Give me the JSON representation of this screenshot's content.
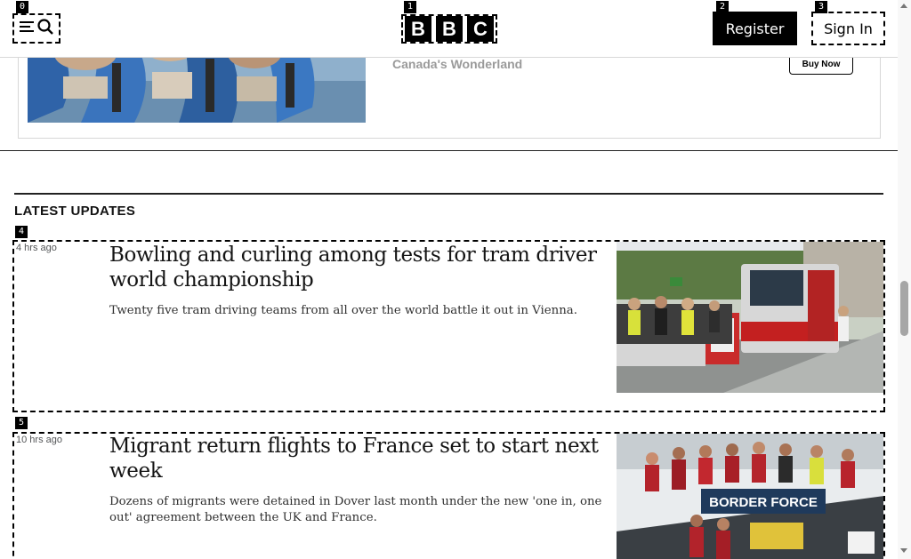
{
  "header": {
    "menu_label": "Menu and search",
    "logo_letters": [
      "B",
      "B",
      "C"
    ],
    "register_label": "Register",
    "signin_label": "Sign In"
  },
  "markers": [
    "0",
    "1",
    "2",
    "3",
    "4",
    "5"
  ],
  "ad": {
    "sponsor": "Canada's Wonderland",
    "buy_label": "Buy Now"
  },
  "latest": {
    "title": "LATEST UPDATES",
    "stories": [
      {
        "time": "4 hrs ago",
        "headline": "Bowling and curling among tests for tram driver world championship",
        "summary": "Twenty five tram driving teams from all over the world battle it out in Vienna."
      },
      {
        "time": "10 hrs ago",
        "headline": "Migrant return flights to France set to start next week",
        "summary": "Dozens of migrants were detained in Dover last month under the new 'one in, one out' agreement between the UK and France.",
        "image_sign": "BORDER FORCE"
      }
    ]
  },
  "icons": {
    "menu": "hamburger-icon",
    "search": "search-icon"
  }
}
